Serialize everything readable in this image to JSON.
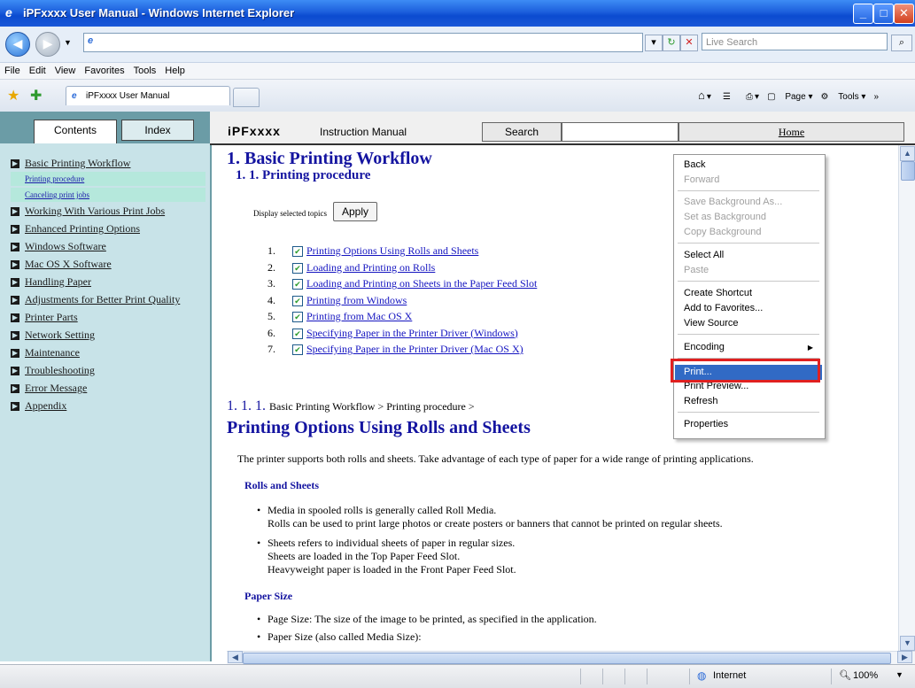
{
  "window": {
    "title": "iPFxxxx User Manual - Windows Internet Explorer"
  },
  "addressbar": {
    "search_placeholder": "Live Search"
  },
  "menubar": [
    "File",
    "Edit",
    "View",
    "Favorites",
    "Tools",
    "Help"
  ],
  "tabs": {
    "active": "iPFxxxx User Manual"
  },
  "toolbar": {
    "page": "Page",
    "tools": "Tools"
  },
  "sidebar": {
    "tabs": [
      "Contents",
      "Index"
    ],
    "items": [
      {
        "label": "Basic Printing Workflow",
        "sub": [
          "Printing procedure",
          "Canceling print jobs"
        ]
      },
      {
        "label": "Working With Various Print Jobs"
      },
      {
        "label": "Enhanced Printing Options"
      },
      {
        "label": "Windows Software"
      },
      {
        "label": "Mac OS X Software"
      },
      {
        "label": "Handling Paper"
      },
      {
        "label": "Adjustments for Better Print Quality"
      },
      {
        "label": "Printer Parts"
      },
      {
        "label": "Network Setting"
      },
      {
        "label": "Maintenance"
      },
      {
        "label": "Troubleshooting"
      },
      {
        "label": "Error Message"
      },
      {
        "label": "Appendix"
      }
    ]
  },
  "mainbar": {
    "brand": "iPFxxxx",
    "brand_sub": "Instruction Manual",
    "search": "Search",
    "home": "Home"
  },
  "doc": {
    "h1": "1. Basic Printing Workflow",
    "h2": "1. 1. Printing procedure",
    "display_topics": "Display selected topics",
    "apply": "Apply",
    "topics": [
      {
        "n": "1.",
        "label": "Printing Options Using Rolls and Sheets"
      },
      {
        "n": "2.",
        "label": "Loading and Printing on Rolls"
      },
      {
        "n": "3.",
        "label": "Loading and Printing on Sheets in the Paper Feed Slot"
      },
      {
        "n": "4.",
        "label": "Printing from Windows"
      },
      {
        "n": "5.",
        "label": "Printing from Mac OS X"
      },
      {
        "n": "6.",
        "label": "Specifying Paper in the Printer Driver (Windows)"
      },
      {
        "n": "7.",
        "label": "Specifying Paper in the Printer Driver (Mac OS X)"
      }
    ],
    "sect_num": "1. 1. 1.",
    "sect_crumb": "Basic Printing Workflow > Printing procedure >",
    "sect_title": "Printing Options Using Rolls and Sheets",
    "intro": "The printer supports both rolls and sheets. Take advantage of each type of paper for a wide range of printing applications.",
    "rolls_head": "Rolls and Sheets",
    "b1_l1": "Media in spooled rolls is generally called Roll Media.",
    "b1_l2": "Rolls can be used to print large photos or create posters or banners that cannot be printed on regular sheets.",
    "b2_l1": "Sheets refers to individual sheets of paper in regular sizes.",
    "b2_l2": "Sheets are loaded in the Top Paper Feed Slot.",
    "b2_l3": "Heavyweight paper is loaded in the Front Paper Feed Slot.",
    "size_head": "Paper Size",
    "b3": "Page Size: The size of the image to be printed, as specified in the application.",
    "b4": "Paper Size (also called Media Size):"
  },
  "context_menu": {
    "back": "Back",
    "forward": "Forward",
    "save_bg": "Save Background As...",
    "set_bg": "Set as Background",
    "copy_bg": "Copy Background",
    "select_all": "Select All",
    "paste": "Paste",
    "create_shortcut": "Create Shortcut",
    "add_fav": "Add to Favorites...",
    "view_source": "View Source",
    "encoding": "Encoding",
    "print": "Print...",
    "print_preview": "Print Preview...",
    "refresh": "Refresh",
    "properties": "Properties"
  },
  "statusbar": {
    "zone": "Internet",
    "zoom": "100%"
  },
  "colors": {
    "highlight": "#316ac5",
    "callout": "#e02020",
    "sidebar_bg": "#c8e3e8",
    "link": "#1414c0"
  }
}
